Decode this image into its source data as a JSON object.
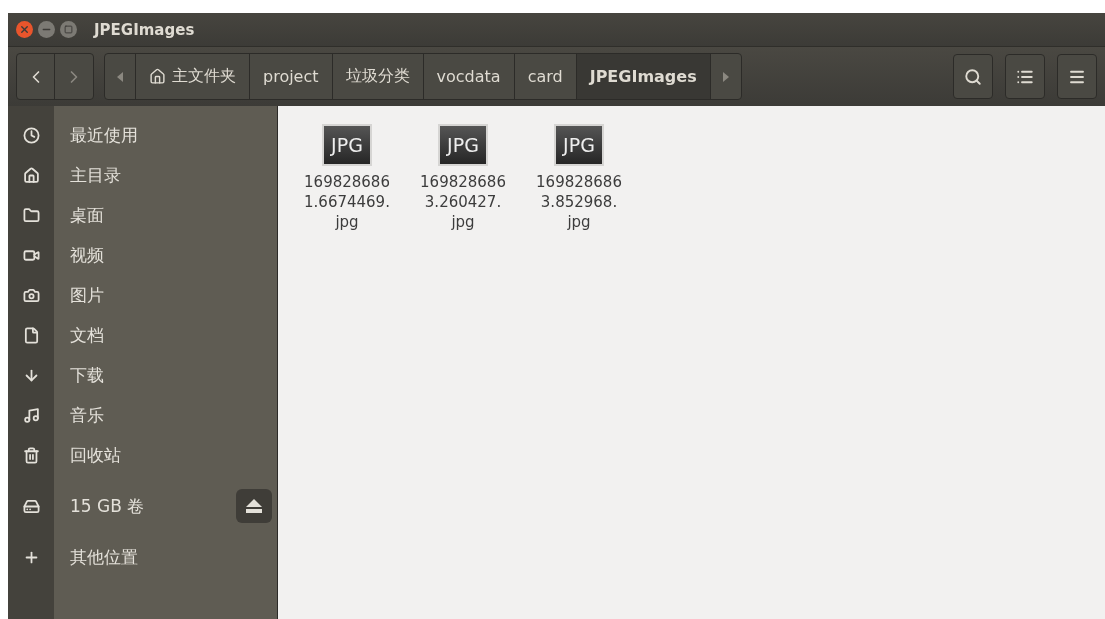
{
  "window": {
    "title": "JPEGImages"
  },
  "path_bar": [
    {
      "label": "主文件夹",
      "kind": "home",
      "selected": false
    },
    {
      "label": "project",
      "kind": "folder",
      "selected": false
    },
    {
      "label": "垃圾分类",
      "kind": "folder",
      "selected": false
    },
    {
      "label": "vocdata",
      "kind": "folder",
      "selected": false
    },
    {
      "label": "card",
      "kind": "folder",
      "selected": false
    },
    {
      "label": "JPEGImages",
      "kind": "folder",
      "selected": true
    }
  ],
  "sidebar": {
    "items": [
      {
        "label": "最近使用",
        "kind": "place"
      },
      {
        "label": "主目录",
        "kind": "place"
      },
      {
        "label": "桌面",
        "kind": "place"
      },
      {
        "label": "视频",
        "kind": "place"
      },
      {
        "label": "图片",
        "kind": "place"
      },
      {
        "label": "文档",
        "kind": "place"
      },
      {
        "label": "下载",
        "kind": "place"
      },
      {
        "label": "音乐",
        "kind": "place"
      },
      {
        "label": "回收站",
        "kind": "place"
      },
      {
        "label": "15 GB 卷",
        "kind": "volume"
      },
      {
        "label": "其他位置",
        "kind": "other"
      }
    ]
  },
  "files": [
    {
      "badge": "JPG",
      "name_lines": [
        "169828686",
        "1.6674469.",
        "jpg"
      ]
    },
    {
      "badge": "JPG",
      "name_lines": [
        "169828686",
        "3.260427.",
        "jpg"
      ]
    },
    {
      "badge": "JPG",
      "name_lines": [
        "169828686",
        "3.852968.",
        "jpg"
      ]
    }
  ]
}
